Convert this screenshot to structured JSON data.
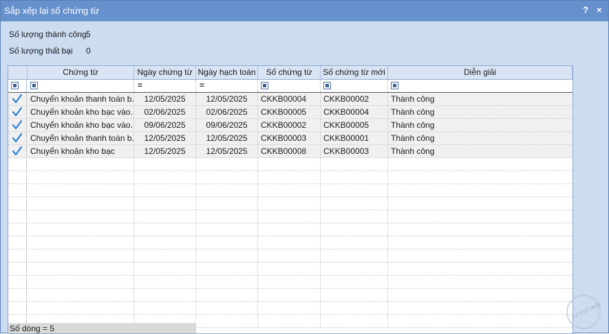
{
  "window": {
    "title": "Sắp xếp lại số chứng từ",
    "help": "?",
    "close": "×"
  },
  "summary": {
    "success_label": "Số lượng thành công",
    "success_value": "5",
    "fail_label": "Số lượng thất bại",
    "fail_value": "0"
  },
  "grid": {
    "columns": [
      "Chứng từ",
      "Ngày chứng từ",
      "Ngày hạch toán",
      "Số chứng từ",
      "Số chứng từ mới",
      "Diễn giải"
    ],
    "filter_eq": "=",
    "rows": [
      [
        "Chuyển khoản thanh toán b...",
        "12/05/2025",
        "12/05/2025",
        "CKKB00004",
        "CKKB00002",
        "Thành công"
      ],
      [
        "Chuyển khoản kho bạc vào...",
        "02/06/2025",
        "02/06/2025",
        "CKKB00005",
        "CKKB00004",
        "Thành công"
      ],
      [
        "Chuyển khoản kho bạc vào...",
        "09/06/2025",
        "09/06/2025",
        "CKKB00002",
        "CKKB00005",
        "Thành công"
      ],
      [
        "Chuyển khoản thanh toán b...",
        "12/05/2025",
        "12/05/2025",
        "CKKB00003",
        "CKKB00001",
        "Thành công"
      ],
      [
        "Chuyển khoản kho bạc",
        "12/05/2025",
        "12/05/2025",
        "CKKB00008",
        "CKKB00003",
        "Thành công"
      ]
    ],
    "footer": "Số dòng = 5"
  },
  "watermark": "TỰ HỌC MISA",
  "colors": {
    "titlebar": "#6691cc",
    "check": "#2a7fd4"
  }
}
